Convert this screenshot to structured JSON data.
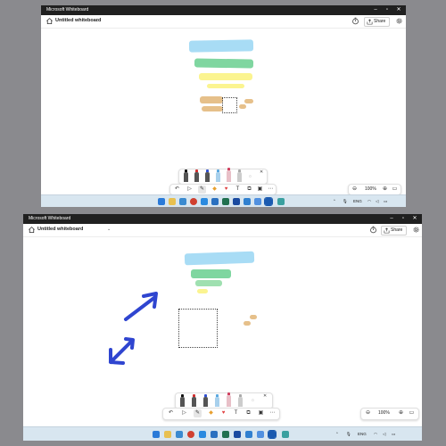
{
  "window_title": "Microsoft Whiteboard",
  "board_title": "Untitled whiteboard",
  "share_label": "Share",
  "zoom_level": "100%",
  "tray_language": "ENG",
  "icons": {
    "home": "home-icon",
    "chevron": "chevron-down-icon",
    "timer": "timer-icon",
    "share": "share-icon",
    "settings": "gear-icon",
    "undo": "undo-icon",
    "select": "select-icon",
    "pen": "pen-icon",
    "shapes": "shapes-icon",
    "reactions": "reaction-icon",
    "text": "text-icon",
    "copy": "copy-icon",
    "more": "more-icon",
    "zoom_out": "zoom-out-icon",
    "zoom_in": "zoom-in-icon",
    "fit": "fit-to-screen-icon",
    "start": "windows-start-icon"
  },
  "colors": {
    "highlighter_blue": "#a8dcf5",
    "highlighter_green": "#7fd6a0",
    "highlighter_yellow": "#fbf490",
    "highlighter_tan": "#e6c08a",
    "arrow_blue": "#2f45d0",
    "taskbar": "#d8e6f0"
  }
}
